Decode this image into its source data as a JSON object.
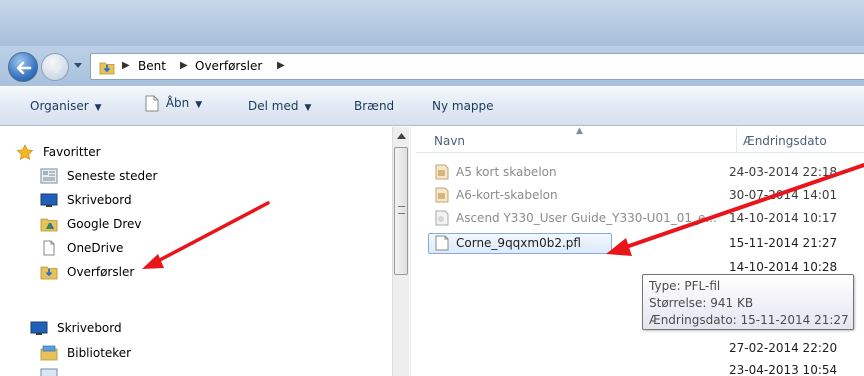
{
  "breadcrumb": {
    "items": [
      "Bent",
      "Overførsler"
    ]
  },
  "toolbar": {
    "organise": "Organiser",
    "open": "Åbn",
    "share": "Del med",
    "burn": "Brænd",
    "new_folder": "Ny mappe"
  },
  "navigation": {
    "favorites_header": "Favoritter",
    "favorites": [
      {
        "label": "Seneste steder",
        "icon": "recent-places-icon"
      },
      {
        "label": "Skrivebord",
        "icon": "desktop-icon"
      },
      {
        "label": "Google Drev",
        "icon": "google-drive-folder-icon"
      },
      {
        "label": "OneDrive",
        "icon": "onedrive-icon"
      },
      {
        "label": "Overførsler",
        "icon": "downloads-folder-icon"
      }
    ],
    "desktop_header": "Skrivebord",
    "desktop_children": [
      {
        "label": "Biblioteker",
        "icon": "libraries-icon"
      }
    ]
  },
  "files": {
    "columns": {
      "name": "Navn",
      "modified": "Ændringsdato"
    },
    "rows": [
      {
        "name": "A5 kort skabelon",
        "date": "24-03-2014 22:18",
        "icon": "word-document-icon",
        "state": "dimmed"
      },
      {
        "name": "A6-kort-skabelon",
        "date": "30-07-2014 14:01",
        "icon": "word-document-icon",
        "state": "dimmed"
      },
      {
        "name": "Ascend Y330_User Guide_Y330-U01_01_e...",
        "date": "14-10-2014 10:17",
        "icon": "pdf-document-icon",
        "state": "dimmed"
      },
      {
        "name": "Corne_9qqxm0b2.pfl",
        "date": "15-11-2014 21:27",
        "icon": "blank-file-icon",
        "state": "selected"
      },
      {
        "name": "",
        "date": "14-10-2014 10:28",
        "icon": "",
        "state": "partially-hidden"
      },
      {
        "name": "",
        "date": "27-02-2014 22:20",
        "icon": "",
        "state": "normal"
      },
      {
        "name": "",
        "date": "23-04-2013 10:54",
        "icon": "",
        "state": "normal"
      }
    ]
  },
  "tooltip": {
    "type_line": "Type: PFL-fil",
    "size_line": "Størrelse: 941 KB",
    "date_line": "Ændringsdato: 15-11-2014 21:27"
  },
  "colors": {
    "annotation_arrow": "#e8151b",
    "selection_border": "#84acdd",
    "command_text": "#1e395b"
  }
}
